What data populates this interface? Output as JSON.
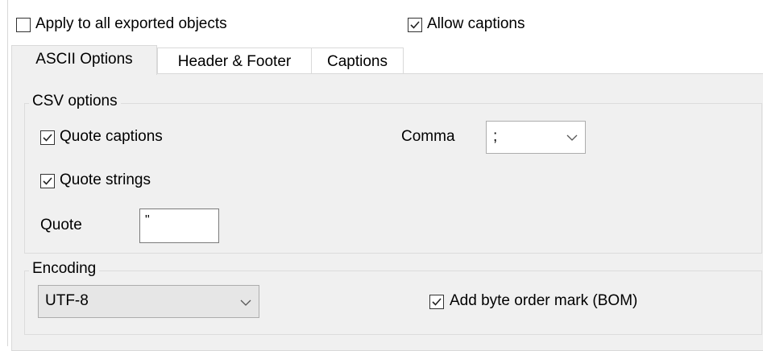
{
  "top": {
    "apply_all": {
      "label": "Apply to all exported objects",
      "checked": false
    },
    "allow_captions": {
      "label": "Allow captions",
      "checked": true
    }
  },
  "tabs": [
    {
      "label": "ASCII Options",
      "active": true
    },
    {
      "label": "Header & Footer",
      "active": false
    },
    {
      "label": "Captions",
      "active": false
    }
  ],
  "csv": {
    "title": "CSV options",
    "quote_captions": {
      "label": "Quote captions",
      "checked": true
    },
    "quote_strings": {
      "label": "Quote strings",
      "checked": true
    },
    "quote_label": "Quote",
    "quote_value": "\"",
    "comma_label": "Comma",
    "comma_value": ";"
  },
  "encoding": {
    "title": "Encoding",
    "value": "UTF-8",
    "bom": {
      "label": "Add byte order mark (BOM)",
      "checked": true
    }
  }
}
